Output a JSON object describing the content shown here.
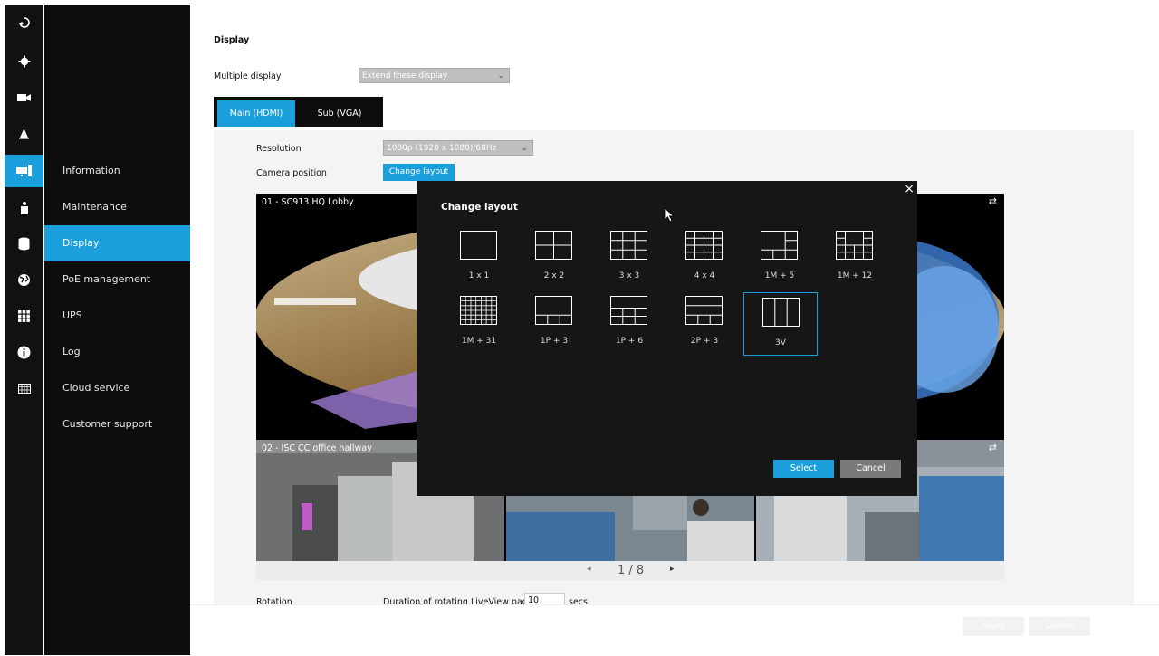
{
  "rail": {
    "items": [
      {
        "icon": "refresh-icon"
      },
      {
        "icon": "gear-icon"
      },
      {
        "icon": "camera-icon"
      },
      {
        "icon": "bell-icon"
      },
      {
        "icon": "display-icon"
      },
      {
        "icon": "user-icon"
      },
      {
        "icon": "database-icon"
      },
      {
        "icon": "globe-icon"
      },
      {
        "icon": "grid-icon"
      },
      {
        "icon": "info-icon"
      },
      {
        "icon": "calendar-icon"
      }
    ],
    "active_index": 4
  },
  "menu": {
    "items": [
      "Information",
      "Maintenance",
      "Display",
      "PoE management",
      "UPS",
      "Log",
      "Cloud service",
      "Customer support"
    ],
    "active": "Display"
  },
  "page": {
    "title": "Display",
    "multiple_display_label": "Multiple display",
    "multiple_display_value": "Extend these display",
    "tabs": [
      "Main (HDMI)",
      "Sub (VGA)"
    ],
    "active_tab": "Main (HDMI)",
    "resolution_label": "Resolution",
    "resolution_value": "1080p (1920 x 1080)/60Hz",
    "camera_position_label": "Camera position",
    "change_layout_button": "Change layout",
    "tiles": [
      {
        "caption": "01 - SC913 HQ Lobby"
      },
      {
        "caption": "02 - ISC CC office hallway"
      }
    ],
    "pager": {
      "text": "1 / 8",
      "prev": "◂",
      "next": "▸"
    },
    "rotation_label": "Rotation",
    "rotation_duration_label": "Duration of rotating LiveView pages",
    "rotation_value": "10",
    "rotation_unit": "secs",
    "footer": {
      "apply": "Apply",
      "cancel": "Cancel"
    }
  },
  "modal": {
    "title": "Change layout",
    "close": "×",
    "options": [
      "1 x 1",
      "2 x 2",
      "3 x 3",
      "4 x 4",
      "1M + 5",
      "1M + 12",
      "1M + 31",
      "1P + 3",
      "1P + 6",
      "2P + 3",
      "3V"
    ],
    "selected": "3V",
    "select_button": "Select",
    "cancel_button": "Cancel"
  },
  "colors": {
    "accent": "#1a9fdc",
    "rail_bg": "#111111",
    "modal_bg": "#161616"
  }
}
